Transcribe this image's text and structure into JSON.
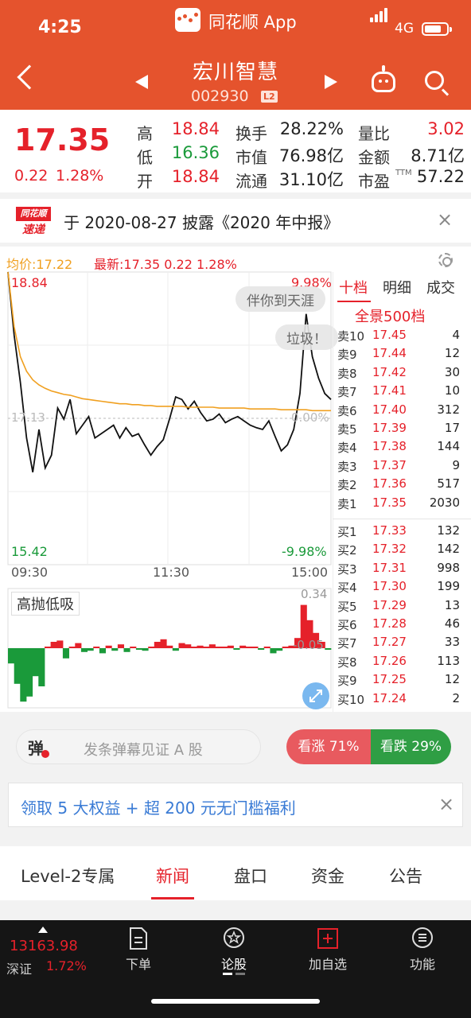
{
  "status": {
    "time": "4:25",
    "network": "4G"
  },
  "app": {
    "name": "同花顺 App"
  },
  "stock": {
    "name": "宏川智慧",
    "code": "002930",
    "level_badge": "L2"
  },
  "quote": {
    "price": "17.35",
    "change": "0.22",
    "change_pct": "1.28%",
    "high_label": "高",
    "high": "18.84",
    "low_label": "低",
    "low": "16.36",
    "open_label": "开",
    "open": "18.84",
    "turnover_label": "换手",
    "turnover": "28.22%",
    "mktcap_label": "市值",
    "mktcap": "76.98亿",
    "float_label": "流通",
    "float": "31.10亿",
    "volratio_label": "量比",
    "volratio": "3.02",
    "amount_label": "金额",
    "amount": "8.71亿",
    "pe_label": "市盈",
    "pe_tm": "TTM",
    "pe": "57.22"
  },
  "news": {
    "badge_top": "同花顺",
    "badge_bottom": "速递",
    "text": "于 2020-08-27 披露《2020 年中报》"
  },
  "chart": {
    "avg_label": "均价:17.22",
    "last_label": "最新:17.35  0.22  1.28%",
    "top_price": "18.84",
    "top_pct": "9.98%",
    "mid_price": "17.13",
    "mid_pct": "0.00%",
    "bottom_price": "15.42",
    "bottom_pct": "-9.98%",
    "times": [
      "09:30",
      "11:30",
      "15:00"
    ],
    "danmaku": [
      "伴你到天涯",
      "垃圾！"
    ],
    "indicator_label": "高抛低吸",
    "indicator_top": "0.34",
    "indicator_bottom": "-0.05"
  },
  "chart_data": {
    "type": "line",
    "title": "",
    "xlabel": "",
    "ylabel": "",
    "x_ticks": [
      "09:30",
      "11:30",
      "15:00"
    ],
    "ylim": [
      15.42,
      18.84
    ],
    "series": [
      {
        "name": "最新",
        "color": "#111111",
        "values": [
          18.84,
          18.1,
          17.55,
          16.9,
          16.5,
          17.0,
          16.55,
          16.7,
          17.25,
          17.12,
          17.35,
          16.95,
          17.05,
          17.15,
          16.9,
          16.95,
          17.0,
          17.05,
          16.9,
          17.02,
          16.92,
          16.95,
          16.82,
          16.7,
          16.8,
          16.88,
          17.12,
          17.38,
          17.35,
          17.24,
          17.33,
          17.2,
          17.1,
          17.12,
          17.18,
          17.08,
          17.12,
          17.15,
          17.1,
          17.05,
          17.02,
          17.0,
          17.1,
          16.92,
          16.75,
          16.82,
          17.0,
          17.42,
          18.35,
          17.85,
          17.6,
          17.42,
          17.35
        ]
      },
      {
        "name": "均价",
        "color": "#f0a020",
        "values": [
          18.84,
          18.2,
          17.85,
          17.68,
          17.58,
          17.52,
          17.48,
          17.45,
          17.43,
          17.41,
          17.4,
          17.38,
          17.36,
          17.35,
          17.34,
          17.33,
          17.32,
          17.31,
          17.3,
          17.3,
          17.29,
          17.29,
          17.28,
          17.28,
          17.27,
          17.27,
          17.27,
          17.27,
          17.27,
          17.26,
          17.26,
          17.26,
          17.26,
          17.26,
          17.25,
          17.25,
          17.25,
          17.25,
          17.25,
          17.24,
          17.24,
          17.24,
          17.24,
          17.24,
          17.23,
          17.23,
          17.23,
          17.23,
          17.23,
          17.22,
          17.22,
          17.22,
          17.22
        ]
      }
    ],
    "indicator": {
      "name": "高抛低吸",
      "values": [
        -0.12,
        -0.28,
        -0.42,
        -0.38,
        -0.22,
        -0.3,
        0.0,
        0.05,
        0.06,
        -0.08,
        0.0,
        0.04,
        -0.03,
        -0.02,
        0.0,
        -0.04,
        0.02,
        -0.02,
        0.03,
        -0.03,
        0.01,
        -0.01,
        -0.02,
        0.0,
        0.05,
        0.07,
        0.02,
        -0.02,
        0.04,
        0.03,
        0.0,
        0.02,
        0.01,
        0.03,
        0.0,
        0.01,
        0.02,
        -0.01,
        0.02,
        0.01,
        0.0,
        -0.01,
        0.01,
        -0.04,
        -0.02,
        0.0,
        0.02,
        0.08,
        0.34,
        0.22,
        0.12,
        0.05,
        -0.01
      ]
    }
  },
  "order_book": {
    "tabs": [
      "十档",
      "明细",
      "成交"
    ],
    "full_label": "全景500档",
    "asks": [
      {
        "label": "卖10",
        "price": "17.45",
        "vol": "4"
      },
      {
        "label": "卖9",
        "price": "17.44",
        "vol": "12"
      },
      {
        "label": "卖8",
        "price": "17.42",
        "vol": "30"
      },
      {
        "label": "卖7",
        "price": "17.41",
        "vol": "10"
      },
      {
        "label": "卖6",
        "price": "17.40",
        "vol": "312"
      },
      {
        "label": "卖5",
        "price": "17.39",
        "vol": "17"
      },
      {
        "label": "卖4",
        "price": "17.38",
        "vol": "144"
      },
      {
        "label": "卖3",
        "price": "17.37",
        "vol": "9"
      },
      {
        "label": "卖2",
        "price": "17.36",
        "vol": "517"
      },
      {
        "label": "卖1",
        "price": "17.35",
        "vol": "2030"
      }
    ],
    "bids": [
      {
        "label": "买1",
        "price": "17.33",
        "vol": "132"
      },
      {
        "label": "买2",
        "price": "17.32",
        "vol": "142"
      },
      {
        "label": "买3",
        "price": "17.31",
        "vol": "998"
      },
      {
        "label": "买4",
        "price": "17.30",
        "vol": "199"
      },
      {
        "label": "买5",
        "price": "17.29",
        "vol": "13"
      },
      {
        "label": "买6",
        "price": "17.28",
        "vol": "46"
      },
      {
        "label": "买7",
        "price": "17.27",
        "vol": "33"
      },
      {
        "label": "买8",
        "price": "17.26",
        "vol": "113"
      },
      {
        "label": "买9",
        "price": "17.25",
        "vol": "12"
      },
      {
        "label": "买10",
        "price": "17.24",
        "vol": "2"
      }
    ]
  },
  "barrage": {
    "icon_text": "弹",
    "placeholder": "发条弹幕见证 A 股"
  },
  "vote": {
    "up": "看涨 71%",
    "down": "看跌 29%",
    "up_pct": 71
  },
  "promo": {
    "text": "领取 5 大权益 + 超 200 元无门槛福利"
  },
  "tabs": [
    "Level-2专属",
    "新闻",
    "盘口",
    "资金",
    "公告"
  ],
  "active_tab": "新闻",
  "footer": {
    "index_value": "13163.98",
    "index_name": "深证",
    "index_pct": "1.72%",
    "nav": [
      "下单",
      "论股",
      "加自选",
      "功能"
    ]
  },
  "colors": {
    "brand": "#e5532d",
    "up": "#e5212a",
    "down": "#1a9a3a",
    "avg": "#f0a020"
  }
}
